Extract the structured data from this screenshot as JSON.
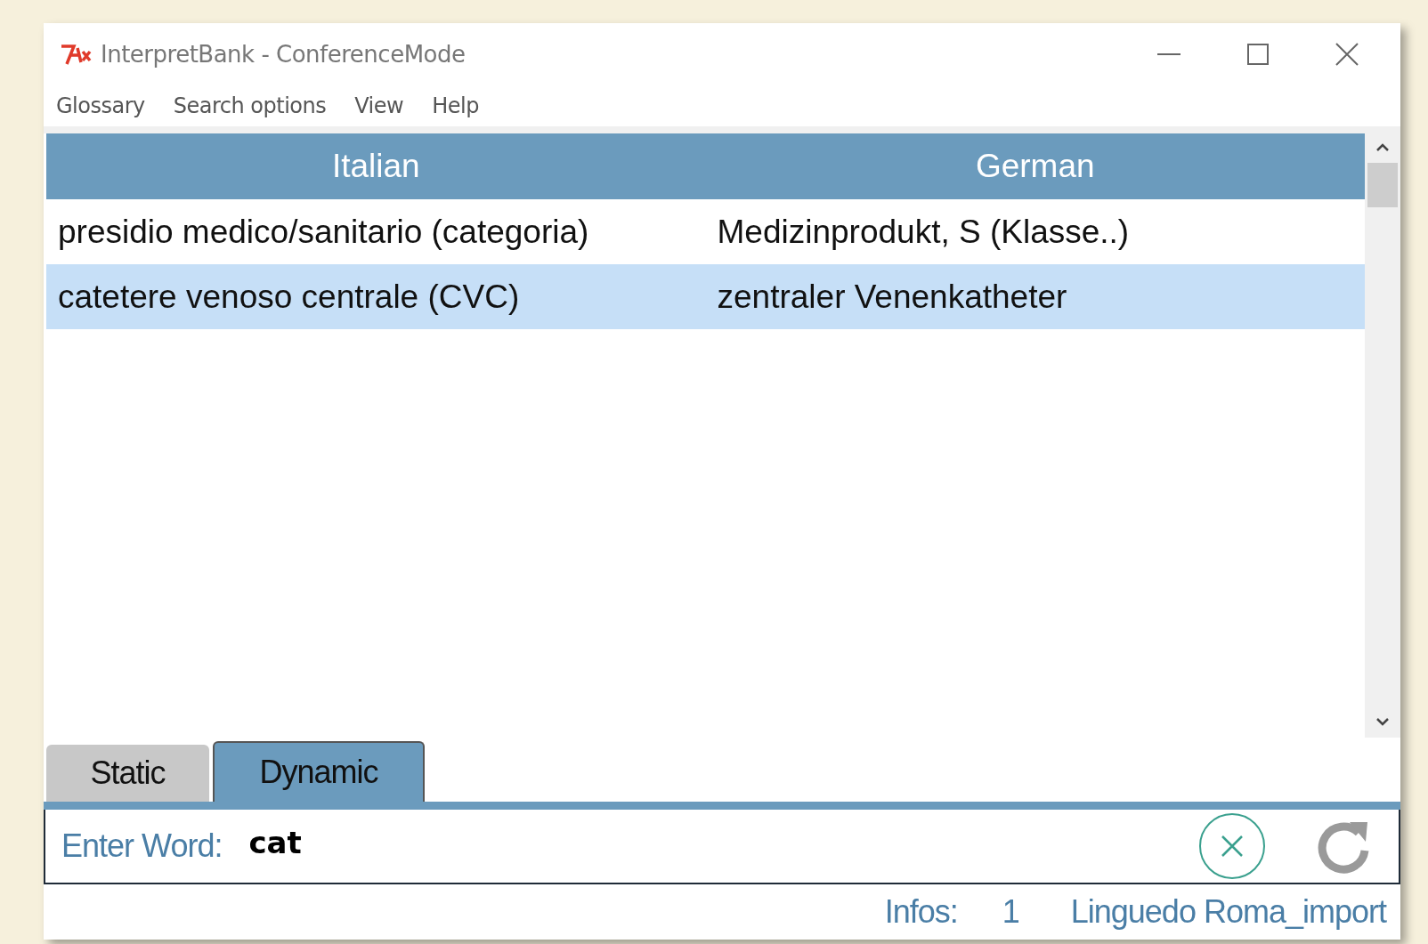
{
  "window": {
    "title": "InterpretBank - ConferenceMode"
  },
  "menu": [
    "Glossary",
    "Search options",
    "View",
    "Help"
  ],
  "table": {
    "columns": [
      "Italian",
      "German"
    ],
    "rows": [
      {
        "cells": [
          "presidio medico/sanitario (categoria)",
          "Medizinprodukt, S (Klasse..)"
        ],
        "selected": false
      },
      {
        "cells": [
          "catetere venoso centrale (CVC)",
          "zentraler Venenkatheter"
        ],
        "selected": true
      }
    ]
  },
  "tabs": [
    {
      "label": "Static",
      "selected": false
    },
    {
      "label": "Dynamic",
      "selected": true
    }
  ],
  "search": {
    "label": "Enter Word:",
    "value": "cat"
  },
  "status_bar": {
    "label": "Infos:",
    "count": "1",
    "glossary": "Linguedo Roma_import"
  }
}
